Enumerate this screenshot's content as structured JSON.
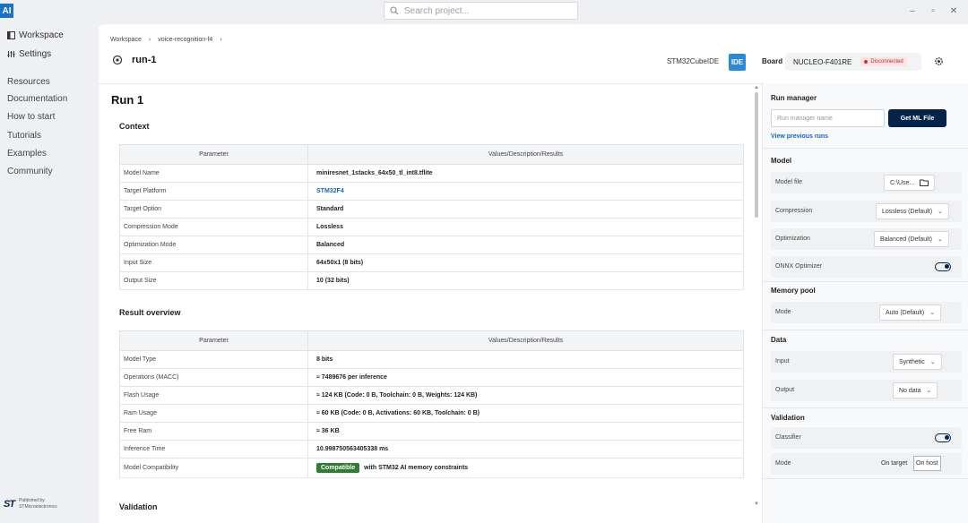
{
  "app": {
    "logo": "AI"
  },
  "search": {
    "placeholder": "Search project..."
  },
  "window": {
    "minimize": "–",
    "maximize": "▫",
    "close": "✕"
  },
  "sidebar": {
    "nav": [
      {
        "label": "Workspace",
        "icon": "workspace-icon"
      },
      {
        "label": "Settings",
        "icon": "settings-icon"
      }
    ],
    "links": [
      "Resources",
      "Documentation",
      "How to start",
      "Tutorials",
      "Examples",
      "Community"
    ],
    "footer": {
      "brand": "ST",
      "line1": "Published by",
      "line2": "STMicroelectronics"
    }
  },
  "breadcrumb": {
    "items": [
      "Workspace",
      "voice-recognition-f4"
    ],
    "sep": "›"
  },
  "run": {
    "name": "run-1",
    "icon": "target-icon"
  },
  "ide": {
    "label": "STM32CubeIDE",
    "button": "IDE"
  },
  "board": {
    "label": "Board",
    "name": "NUCLEO-F401RE",
    "status": "Disconnected"
  },
  "content": {
    "title": "Run 1",
    "context": {
      "heading": "Context",
      "headers": [
        "Parameter",
        "Values/Description/Results"
      ],
      "rows": [
        [
          "Model Name",
          "miniresnet_1stacks_64x50_tl_int8.tflite"
        ],
        [
          "Target Platform",
          "STM32F4"
        ],
        [
          "Target Option",
          "Standard"
        ],
        [
          "Compression Mode",
          "Lossless"
        ],
        [
          "Optimization Mode",
          "Balanced"
        ],
        [
          "Input Size",
          "64x50x1 (8 bits)"
        ],
        [
          "Output Size",
          "10 (32 bits)"
        ]
      ]
    },
    "result": {
      "heading": "Result overview",
      "headers": [
        "Parameter",
        "Values/Description/Results"
      ],
      "rows": [
        [
          "Model Type",
          "8 bits"
        ],
        [
          "Operations (MACC)",
          "≈ 7489676 per inference"
        ],
        [
          "Flash Usage",
          "≈ 124 KB (Code: 0 B, Toolchain: 0 B, Weights: 124 KB)"
        ],
        [
          "Ram Usage",
          "≈ 60 KB (Code: 0 B, Activations: 60 KB, Toolchain: 0 B)"
        ],
        [
          "Free Ram",
          "≈ 36 KB"
        ],
        [
          "Inference Time",
          "10.998750563405338 ms"
        ]
      ],
      "compat": {
        "label": "Model Compatibility",
        "badge": "Compatible",
        "text": "with STM32 AI memory constraints"
      }
    },
    "validation": {
      "heading": "Validation"
    }
  },
  "panel": {
    "run_manager": {
      "title": "Run manager",
      "placeholder": "Run manager name",
      "button": "Get ML File",
      "link": "View previous runs"
    },
    "model": {
      "title": "Model",
      "file_label": "Model file",
      "file_value": "C:\\Use...",
      "compression_label": "Compression",
      "compression_value": "Lossless (Default)",
      "optimization_label": "Optimization",
      "optimization_value": "Balanced (Default)",
      "onnx_label": "ONNX Optimizer"
    },
    "memory": {
      "title": "Memory pool",
      "mode_label": "Mode",
      "mode_value": "Auto (Default)"
    },
    "data": {
      "title": "Data",
      "input_label": "Input",
      "input_value": "Synthetic",
      "output_label": "Output",
      "output_value": "No data"
    },
    "validation": {
      "title": "Validation",
      "classifier_label": "Classifier",
      "mode_label": "Mode",
      "opt1": "On target",
      "opt2": "On host"
    }
  }
}
